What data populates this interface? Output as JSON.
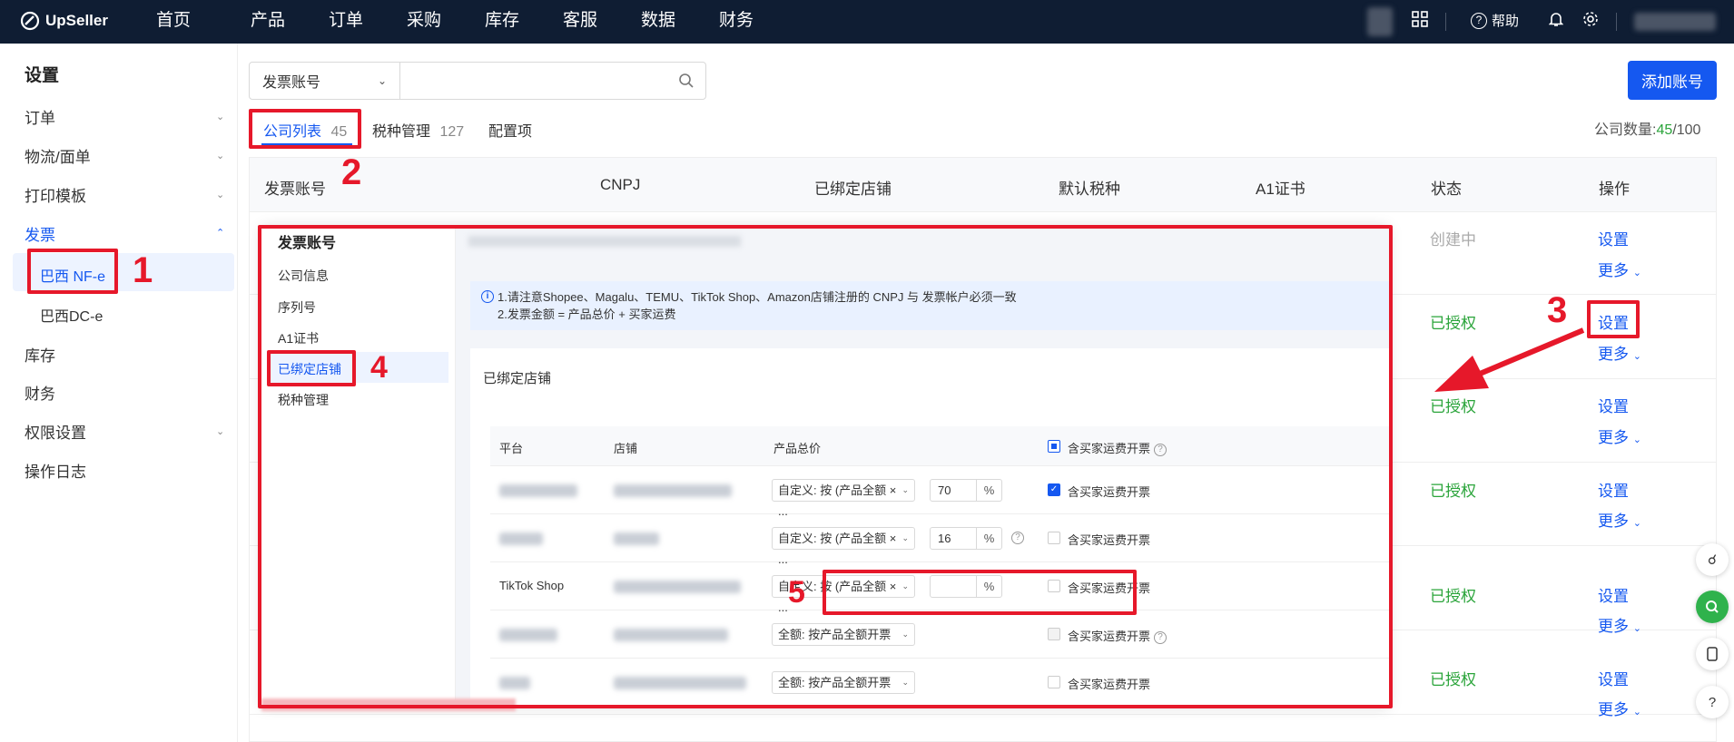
{
  "topbar": {
    "brand": "UpSeller",
    "nav": [
      "首页",
      "产品",
      "订单",
      "采购",
      "库存",
      "客服",
      "数据",
      "财务"
    ],
    "help": "帮助"
  },
  "sidebar": {
    "title": "设置",
    "items": {
      "order": "订单",
      "logistics": "物流/面单",
      "print": "打印模板",
      "invoice": "发票",
      "nfe": "巴西 NF-e",
      "dce": "巴西DC-e",
      "stock": "库存",
      "finance": "财务",
      "perm": "权限设置",
      "log": "操作日志"
    }
  },
  "search": {
    "select": "发票账号",
    "placeholder": ""
  },
  "add_button": "添加账号",
  "tabs": {
    "company": "公司列表",
    "company_count": "45",
    "tax": "税种管理",
    "tax_count": "127",
    "config": "配置项"
  },
  "company_count": {
    "label": "公司数量:",
    "used": "45",
    "total": "/100"
  },
  "table": {
    "headers": [
      "发票账号",
      "CNPJ",
      "已绑定店铺",
      "默认税种",
      "A1证书",
      "状态",
      "操作"
    ],
    "rows": [
      {
        "status": "创建中"
      },
      {
        "status": "已授权"
      },
      {
        "status": "已授权"
      },
      {
        "status": "已授权"
      },
      {
        "status": "已授权"
      },
      {
        "status": "已授权"
      }
    ],
    "setting": "设置",
    "more": "更多"
  },
  "overlay": {
    "nav_title": "发票账号",
    "nav": [
      "公司信息",
      "序列号",
      "A1证书",
      "已绑定店铺",
      "税种管理"
    ],
    "notice1": "1.请注意Shopee、Magalu、TEMU、TikTok Shop、Amazon店铺注册的 CNPJ 与 发票帐户必须一致",
    "notice2": "2.发票金额 = 产品总价 + 买家运费",
    "card_title": "已绑定店铺",
    "cols": {
      "platform": "平台",
      "shop": "店铺",
      "total": "产品总价",
      "freight": "含买家运费开票"
    },
    "rows": [
      {
        "platform": "",
        "dd": "自定义: 按 (产品全额 × ...",
        "pct": "70",
        "freight": "含买家运费开票"
      },
      {
        "platform": "",
        "dd": "自定义: 按 (产品全额 × ...",
        "pct": "16",
        "freight": "含买家运费开票"
      },
      {
        "platform": "TikTok Shop",
        "dd": "自定义: 按 (产品全额 × ...",
        "pct": "",
        "freight": "含买家运费开票"
      },
      {
        "platform": "",
        "dd": "全额: 按产品全额开票",
        "pct": "",
        "freight": "含买家运费开票"
      },
      {
        "platform": "",
        "dd": "全额: 按产品全额开票",
        "pct": "",
        "freight": "含买家运费开票"
      }
    ],
    "percent": "%"
  },
  "markers": [
    "1",
    "2",
    "3",
    "4",
    "5"
  ],
  "colors": {
    "accent": "#1558f0",
    "highlight": "#e6182a",
    "success": "#2aa43a",
    "topbar": "#0f1d33"
  }
}
